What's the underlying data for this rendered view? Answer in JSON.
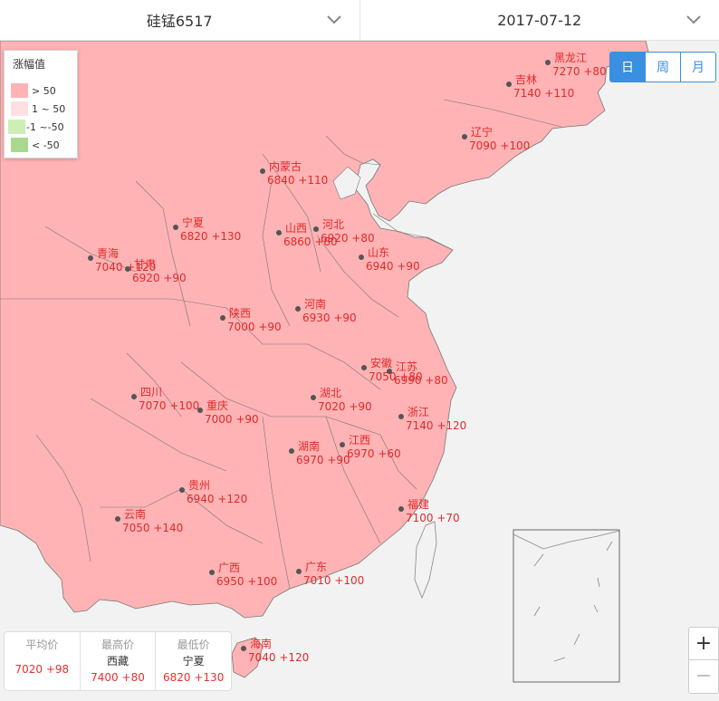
{
  "product_select": {
    "value": "硅锰6517",
    "icon": "chevron-down-icon"
  },
  "date_select": {
    "value": "2017-07-12",
    "icon": "chevron-down-icon"
  },
  "legend": {
    "title": "涨幅值",
    "items": [
      {
        "label": "> 50",
        "color": "#ffb3b5"
      },
      {
        "label": "1 ~ 50",
        "color": "#ffe0e2"
      },
      {
        "label": "-1 ~-50",
        "color": "#cdeeb5"
      },
      {
        "label": "< -50",
        "color": "#a9d88e"
      }
    ]
  },
  "period_tabs": [
    {
      "label": "日",
      "active": true
    },
    {
      "label": "周",
      "active": false
    },
    {
      "label": "月",
      "active": false
    }
  ],
  "provinces": [
    {
      "name": "黑龙江",
      "value": "7270 +80"
    },
    {
      "name": "吉林",
      "value": "7140 +110"
    },
    {
      "name": "辽宁",
      "value": "7090 +100"
    },
    {
      "name": "内蒙古",
      "value": "6840 +110"
    },
    {
      "name": "宁夏",
      "value": "6820 +130"
    },
    {
      "name": "山西",
      "value": "6860 +80"
    },
    {
      "name": "河北",
      "value": "6920 +80"
    },
    {
      "name": "青海",
      "value": "7040 +120"
    },
    {
      "name": "甘肃",
      "value": "6920 +90"
    },
    {
      "name": "山东",
      "value": "6940 +90"
    },
    {
      "name": "河南",
      "value": "6930 +90"
    },
    {
      "name": "陕西",
      "value": "7000 +90"
    },
    {
      "name": "安徽",
      "value": "7050 +80"
    },
    {
      "name": "江苏",
      "value": "6990 +80"
    },
    {
      "name": "四川",
      "value": "7070 +100"
    },
    {
      "name": "湖北",
      "value": "7020 +90"
    },
    {
      "name": "重庆",
      "value": "7000 +90"
    },
    {
      "name": "浙江",
      "value": "7140 +120"
    },
    {
      "name": "江西",
      "value": "6970 +60"
    },
    {
      "name": "湖南",
      "value": "6970 +90"
    },
    {
      "name": "贵州",
      "value": "6940 +120"
    },
    {
      "name": "福建",
      "value": "7100 +70"
    },
    {
      "name": "云南",
      "value": "7050 +140"
    },
    {
      "name": "广西",
      "value": "6950 +100"
    },
    {
      "name": "广东",
      "value": "7010 +100"
    },
    {
      "name": "海南",
      "value": "7040 +120"
    }
  ],
  "stats": {
    "avg": {
      "label": "平均价",
      "value": "7020 +98"
    },
    "max": {
      "label": "最高价",
      "province": "西藏",
      "value": "7400 +80"
    },
    "min": {
      "label": "最低价",
      "province": "宁夏",
      "value": "6820 +130"
    }
  },
  "zoom": {
    "in_label": "+",
    "out_label": "−"
  }
}
